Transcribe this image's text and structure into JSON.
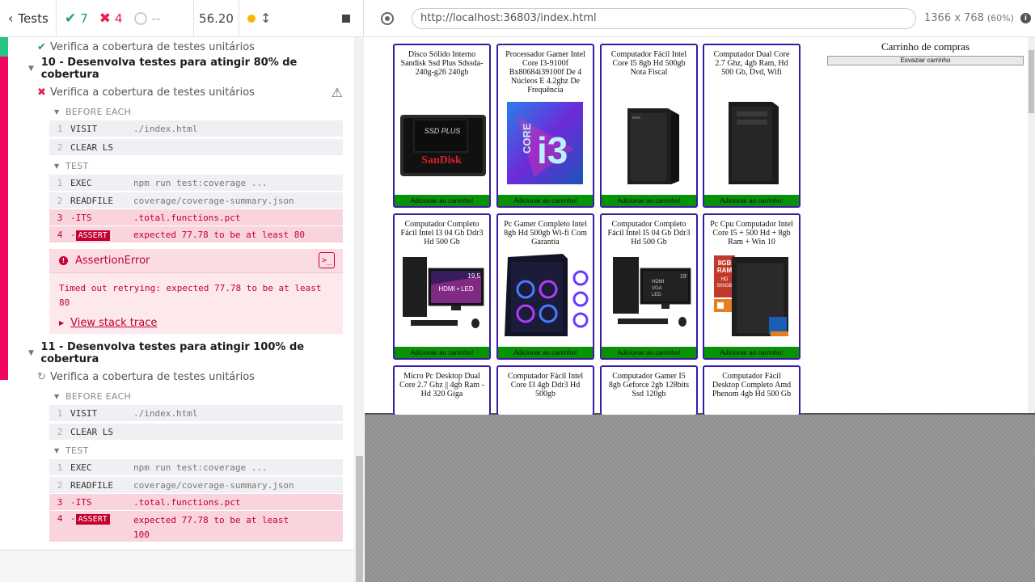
{
  "reporter": {
    "tests_label": "Tests",
    "passed": "7",
    "failed": "4",
    "pending": "--",
    "duration": "56.20"
  },
  "tree": {
    "prev_test": "Verifica a cobertura de testes unitários",
    "suite10": {
      "title": "10 - Desenvolva testes para atingir 80% de cobertura",
      "test": "Verifica a cobertura de testes unitários",
      "before_each": "BEFORE EACH",
      "test_label": "TEST",
      "before_cmds": [
        {
          "num": "1",
          "name": "VISIT",
          "msg": "./index.html"
        },
        {
          "num": "2",
          "name": "CLEAR LS",
          "msg": ""
        }
      ],
      "test_cmds": [
        {
          "num": "1",
          "name": "EXEC",
          "msg": "npm run test:coverage ..."
        },
        {
          "num": "2",
          "name": "READFILE",
          "msg": "coverage/coverage-summary.json"
        },
        {
          "num": "3",
          "name": "-ITS",
          "msg": ".total.functions.pct"
        },
        {
          "num": "4",
          "name": "-",
          "badge": "ASSERT",
          "msg_pre": "expected ",
          "val1": "77.78",
          "msg_mid": " to be at least ",
          "val2": "80"
        }
      ],
      "error": {
        "title": "AssertionError",
        "message": "Timed out retrying: expected 77.78 to be at least 80",
        "stack": "View stack trace"
      }
    },
    "suite11": {
      "title": "11 - Desenvolva testes para atingir 100% de cobertura",
      "test": "Verifica a cobertura de testes unitários",
      "before_each": "BEFORE EACH",
      "test_label": "TEST",
      "before_cmds": [
        {
          "num": "1",
          "name": "VISIT",
          "msg": "./index.html"
        },
        {
          "num": "2",
          "name": "CLEAR LS",
          "msg": ""
        }
      ],
      "test_cmds": [
        {
          "num": "1",
          "name": "EXEC",
          "msg": "npm run test:coverage ..."
        },
        {
          "num": "2",
          "name": "READFILE",
          "msg": "coverage/coverage-summary.json"
        },
        {
          "num": "3",
          "name": "-ITS",
          "msg": ".total.functions.pct"
        },
        {
          "num": "4",
          "name": "-",
          "badge": "ASSERT",
          "msg_pre": "expected ",
          "val1": "77.78",
          "msg_mid": " to be at least",
          "val2": "100"
        }
      ]
    }
  },
  "aut": {
    "url": "http://localhost:36803/index.html",
    "viewport": "1366 x 768",
    "scale": "(60%)"
  },
  "shop": {
    "add_label": "Adicionar ao carrinho!",
    "cart_title": "Carrinho de compras",
    "empty_cart": "Esvaziar carrinho",
    "products": [
      "Disco Sólido Interno Sandisk Ssd Plus Sdssda-240g-g26 240gb",
      "Processador Gamer Intel Core I3-9100f Bx80684i39100f De 4 Núcleos E 4.2ghz De Frequência",
      "Computador Fácil Intel Core I5 8gb Hd 500gb Nota Fiscal",
      "Computador Dual Core 2.7 Ghz, 4gb Ram, Hd 500 Gb, Dvd, Wifi",
      "Computador Completo Fácil Intel I3 04 Gb Ddr3 Hd 500 Gb",
      "Pc Gamer Completo Intel 8gb Hd 500gb Wi-fi Com Garantia",
      "Computador Completo Fácil Intel I5 04 Gb Ddr3 Hd 500 Gb",
      "Pc Cpu Computador Intel Core I5 + 500 Hd + 8gb Ram + Win 10",
      "Micro Pc Desktop Dual Core 2.7 Ghz || 4gb Ram - Hd 320 Giga",
      "Computador Fácil Intel Core I3 4gb Ddr3 Hd 500gb",
      "Computador Gamer I5 8gb Geforce 2gb 128bits Ssd 120gb",
      "Computador Fácil Desktop Completo Amd Phenom 4gb Hd 500 Gb"
    ],
    "img_text": {
      "ssd_line1": "SSD PLUS",
      "ssd_brand": "SanDisk",
      "cpu_core": "CORE",
      "cpu_i3": "i3",
      "mon1_size": "19,5",
      "mon1_label": "HDMI • LED",
      "mon2_size": "19'",
      "mon2_l1": "HDMI",
      "mon2_l2": "VGA",
      "mon2_l3": "LED",
      "spec_8gb": "8GB",
      "spec_ram": "RAM",
      "spec_hd": "HD",
      "spec_500": "500GB"
    }
  }
}
